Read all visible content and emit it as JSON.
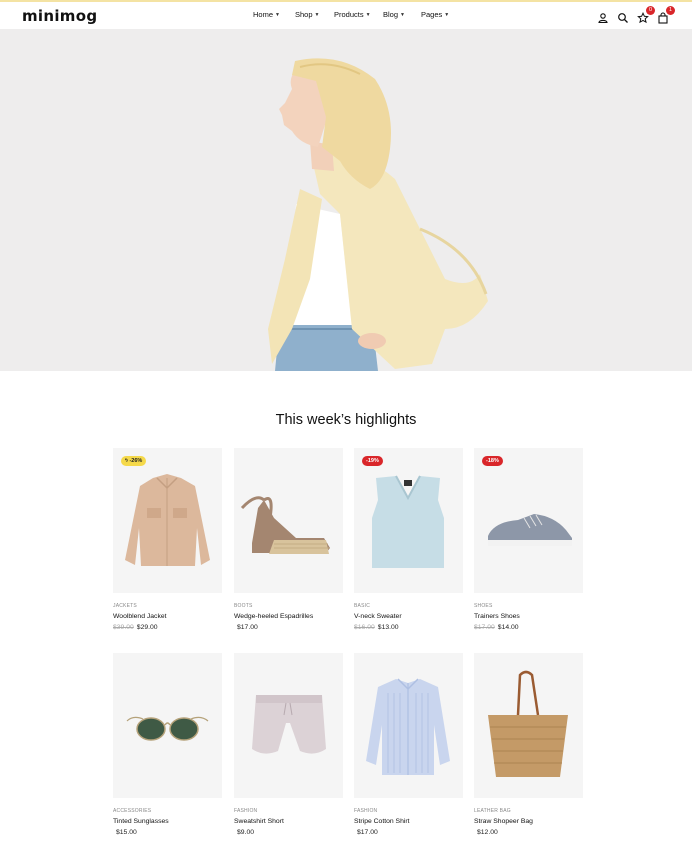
{
  "header": {
    "logo": "minimog",
    "nav": [
      {
        "label": "Home"
      },
      {
        "label": "Shop"
      },
      {
        "label": "Products"
      },
      {
        "label": "Blog"
      },
      {
        "label": "Pages"
      }
    ],
    "wishlist_count": "0",
    "cart_count": "1"
  },
  "highlights": {
    "title": "This week’s highlights",
    "products": [
      {
        "category": "JACKETS",
        "name": "Woolblend Jacket",
        "old_price": "$39.00",
        "price": "$29.00",
        "badge": "ϟ -26%",
        "badge_style": "yellow"
      },
      {
        "category": "BOOTS",
        "name": "Wedge-heeled Espadrilles",
        "old_price": "",
        "price": "$17.00",
        "badge": "",
        "badge_style": ""
      },
      {
        "category": "BASIC",
        "name": "V-neck Sweater",
        "old_price": "$16.00",
        "price": "$13.00",
        "badge": "-19%",
        "badge_style": "red"
      },
      {
        "category": "SHOES",
        "name": "Trainers Shoes",
        "old_price": "$17.00",
        "price": "$14.00",
        "badge": "-18%",
        "badge_style": "red"
      },
      {
        "category": "ACCESSORIES",
        "name": "Tinted Sunglasses",
        "old_price": "",
        "price": "$15.00",
        "badge": "",
        "badge_style": ""
      },
      {
        "category": "FASHION",
        "name": "Sweatshirt Short",
        "old_price": "",
        "price": "$9.00",
        "badge": "",
        "badge_style": ""
      },
      {
        "category": "FASHION",
        "name": "Stripe Cotton Shirt",
        "old_price": "",
        "price": "$17.00",
        "badge": "",
        "badge_style": ""
      },
      {
        "category": "LEATHER BAG",
        "name": "Straw Shopeer Bag",
        "old_price": "",
        "price": "$12.00",
        "badge": "",
        "badge_style": ""
      }
    ]
  },
  "colors": {
    "accent": "#d9262a",
    "sale_yellow": "#f5d94a",
    "hero_bg": "#eeeded"
  }
}
